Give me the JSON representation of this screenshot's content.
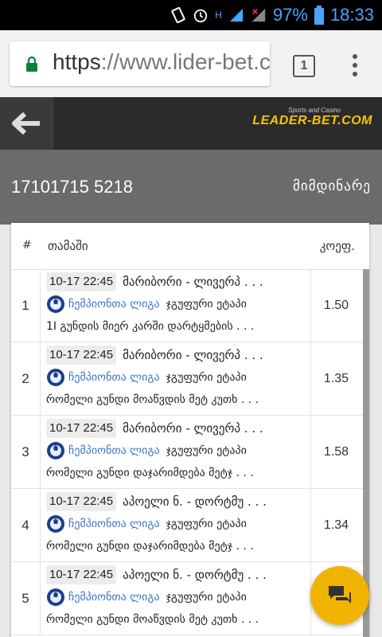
{
  "statusbar": {
    "battery": "97%",
    "time": "18:33",
    "network_type": "H",
    "icons": [
      "vibrate-icon",
      "alarm-icon",
      "signal-icon",
      "signal-no-data-icon",
      "battery-icon"
    ]
  },
  "browser": {
    "url_scheme": "https",
    "url_rest": "://www.lider-bet.co",
    "tab_count": "1",
    "icons": [
      "lock-icon",
      "more-vert-icon"
    ]
  },
  "app": {
    "logo_subtitle": "Sports and Casino",
    "logo_title": "LEADER-BET.COM",
    "accent_color": "#f1c40f"
  },
  "ticket": {
    "id": "17101715 5218",
    "status": "მიმდინარე"
  },
  "table": {
    "headers": {
      "num": "#",
      "game": "თამაში",
      "odds": "კოეფ."
    },
    "rows": [
      {
        "num": "1",
        "datetime": "10-17 22:45",
        "match": "მარიბორი - ლივერპ . . .",
        "league": "ჩემპიონთა ლიგა",
        "stage": "ჯგუფური ეტაპი",
        "market": "1I გუნდის მიერ კარში დარტყმების  . . .",
        "odds": "1.50"
      },
      {
        "num": "2",
        "datetime": "10-17 22:45",
        "match": "მარიბორი - ლივერპ . . .",
        "league": "ჩემპიონთა ლიგა",
        "stage": "ჯგუფური ეტაპი",
        "market": "რომელი გუნდი მოაწვდის მეტ კუთხ . . .",
        "odds": "1.35"
      },
      {
        "num": "3",
        "datetime": "10-17 22:45",
        "match": "მარიბორი - ლივერპ . . .",
        "league": "ჩემპიონთა ლიგა",
        "stage": "ჯგუფური ეტაპი",
        "market": "რომელი გუნდი დაჯარიმდება მეტჯ . . .",
        "odds": "1.58"
      },
      {
        "num": "4",
        "datetime": "10-17 22:45",
        "match": "აპოელი ნ. - დორტმუ . . .",
        "league": "ჩემპიონთა ლიგა",
        "stage": "ჯგუფური ეტაპი",
        "market": "რომელი გუნდი დაჯარიმდება მეტჯ . . .",
        "odds": "1.34"
      },
      {
        "num": "5",
        "datetime": "10-17 22:45",
        "match": "აპოელი ნ. - დორტმუ . . .",
        "league": "ჩემპიონთა ლიგა",
        "stage": "ჯგუფური ეტაპი",
        "market": "რომელი გუნდი მოაწვდის მეტ კუთხ . . .",
        "odds": ""
      }
    ]
  }
}
